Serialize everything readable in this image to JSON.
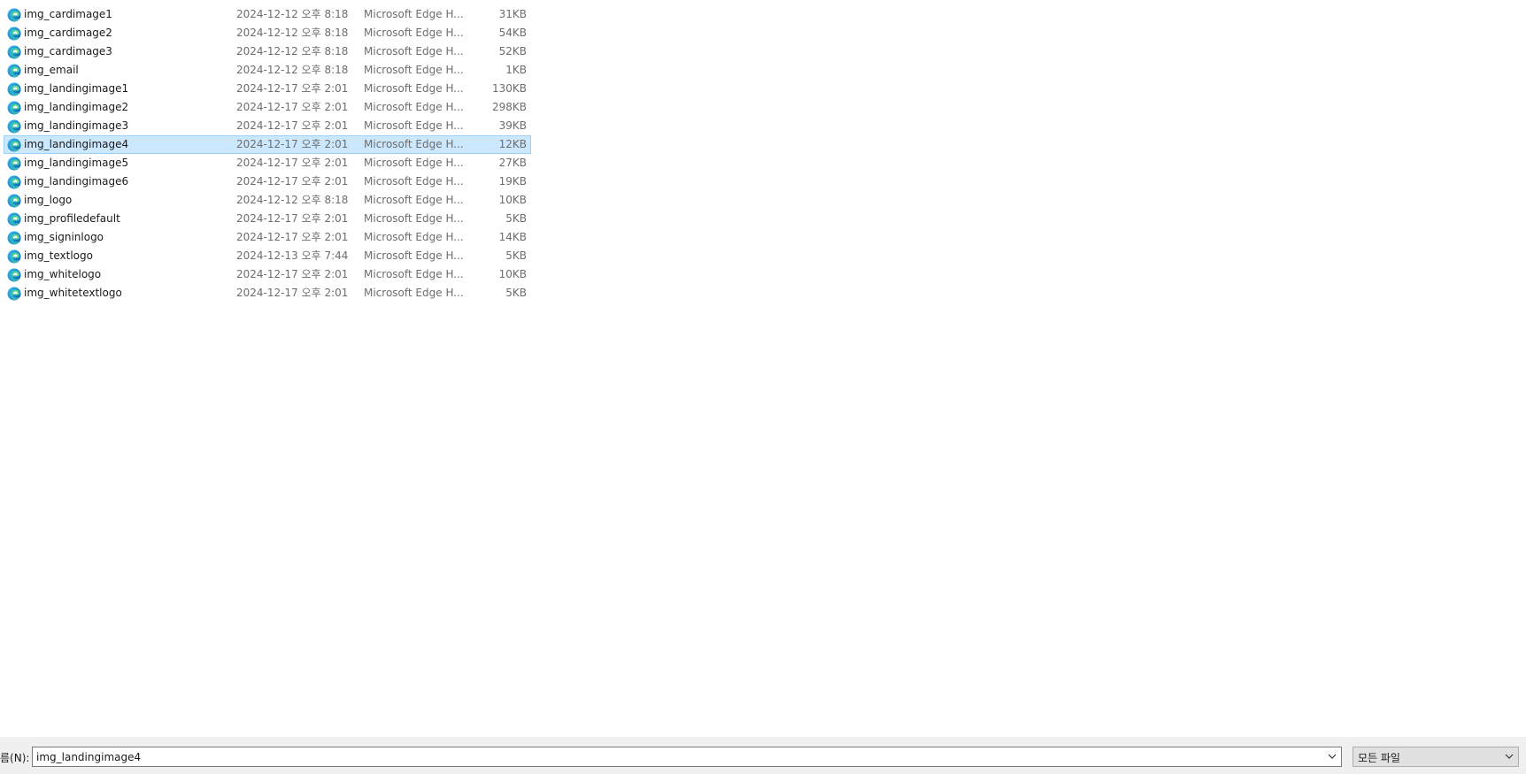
{
  "file_list": {
    "selected_index": 7,
    "items": [
      {
        "name": "img_cardimage1",
        "date": "2024-12-12 오후 8:18",
        "type": "Microsoft Edge H...",
        "size": "31KB"
      },
      {
        "name": "img_cardimage2",
        "date": "2024-12-12 오후 8:18",
        "type": "Microsoft Edge H...",
        "size": "54KB"
      },
      {
        "name": "img_cardimage3",
        "date": "2024-12-12 오후 8:18",
        "type": "Microsoft Edge H...",
        "size": "52KB"
      },
      {
        "name": "img_email",
        "date": "2024-12-12 오후 8:18",
        "type": "Microsoft Edge H...",
        "size": "1KB"
      },
      {
        "name": "img_landingimage1",
        "date": "2024-12-17 오후 2:01",
        "type": "Microsoft Edge H...",
        "size": "130KB"
      },
      {
        "name": "img_landingimage2",
        "date": "2024-12-17 오후 2:01",
        "type": "Microsoft Edge H...",
        "size": "298KB"
      },
      {
        "name": "img_landingimage3",
        "date": "2024-12-17 오후 2:01",
        "type": "Microsoft Edge H...",
        "size": "39KB"
      },
      {
        "name": "img_landingimage4",
        "date": "2024-12-17 오후 2:01",
        "type": "Microsoft Edge H...",
        "size": "12KB"
      },
      {
        "name": "img_landingimage5",
        "date": "2024-12-17 오후 2:01",
        "type": "Microsoft Edge H...",
        "size": "27KB"
      },
      {
        "name": "img_landingimage6",
        "date": "2024-12-17 오후 2:01",
        "type": "Microsoft Edge H...",
        "size": "19KB"
      },
      {
        "name": "img_logo",
        "date": "2024-12-12 오후 8:18",
        "type": "Microsoft Edge H...",
        "size": "10KB"
      },
      {
        "name": "img_profiledefault",
        "date": "2024-12-17 오후 2:01",
        "type": "Microsoft Edge H...",
        "size": "5KB"
      },
      {
        "name": "img_signinlogo",
        "date": "2024-12-17 오후 2:01",
        "type": "Microsoft Edge H...",
        "size": "14KB"
      },
      {
        "name": "img_textlogo",
        "date": "2024-12-13 오후 7:44",
        "type": "Microsoft Edge H...",
        "size": "5KB"
      },
      {
        "name": "img_whitelogo",
        "date": "2024-12-17 오후 2:01",
        "type": "Microsoft Edge H...",
        "size": "10KB"
      },
      {
        "name": "img_whitetextlogo",
        "date": "2024-12-17 오후 2:01",
        "type": "Microsoft Edge H...",
        "size": "5KB"
      }
    ]
  },
  "bottom_bar": {
    "filename_label": "름(N):",
    "filename_value": "img_landingimage4",
    "filetype_value": "모든 파일"
  },
  "icons": {
    "file_icon": "edge-icon",
    "combo_arrow": "chevron-down-icon"
  },
  "colors": {
    "selection_bg": "#cce8ff",
    "selection_border": "#99d1ff",
    "text_primary": "#1a1a1a",
    "text_secondary": "#6d6d6d"
  }
}
